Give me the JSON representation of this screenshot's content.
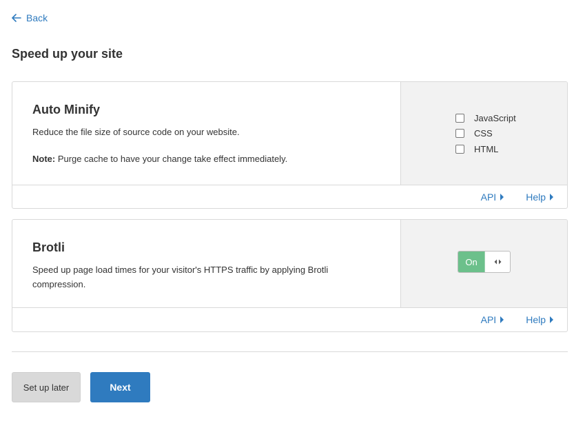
{
  "back": {
    "label": "Back"
  },
  "page_title": "Speed up your site",
  "cards": [
    {
      "title": "Auto Minify",
      "description": "Reduce the file size of source code on your website.",
      "note_label": "Note:",
      "note_text": " Purge cache to have your change take effect immediately.",
      "options": [
        {
          "label": "JavaScript",
          "checked": false
        },
        {
          "label": "CSS",
          "checked": false
        },
        {
          "label": "HTML",
          "checked": false
        }
      ],
      "footer": {
        "api": "API",
        "help": "Help"
      }
    },
    {
      "title": "Brotli",
      "description": "Speed up page load times for your visitor's HTTPS traffic by applying Brotli compression.",
      "toggle": {
        "label": "On",
        "state": "on"
      },
      "footer": {
        "api": "API",
        "help": "Help"
      }
    }
  ],
  "buttons": {
    "later": "Set up later",
    "next": "Next"
  },
  "colors": {
    "link": "#2f7bbf",
    "toggle_on": "#6cc08b",
    "primary": "#2f7bbf",
    "panel": "#f2f2f2"
  },
  "icons": {
    "back": "arrow-left-icon",
    "link_caret": "caret-right-icon",
    "toggle_handle": "drag-handle-icon"
  }
}
